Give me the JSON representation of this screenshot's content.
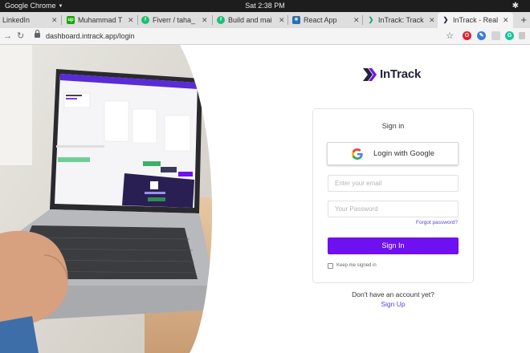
{
  "system_bar": {
    "app_name": "Google Chrome",
    "clock": "Sat   2:38 PM",
    "tray_icon": "slack-icon"
  },
  "tabs": [
    {
      "label": "LinkedIn",
      "favicon": "linkedin-favicon"
    },
    {
      "label": "Muhammad T",
      "favicon": "upwork-favicon",
      "favicon_text": "up",
      "favicon_color": "#14a800"
    },
    {
      "label": "Fiverr / taha_",
      "favicon": "fiverr-favicon",
      "favicon_text": "f",
      "favicon_color": "#1dbf73"
    },
    {
      "label": "Build and mai",
      "favicon": "fiverr-favicon",
      "favicon_text": "f",
      "favicon_color": "#1dbf73"
    },
    {
      "label": "React App",
      "favicon": "react-favicon"
    },
    {
      "label": "InTrack: Track",
      "favicon": "intrack-favicon"
    },
    {
      "label": "InTrack - Real",
      "favicon": "intrack-favicon",
      "active": true
    }
  ],
  "address_bar": {
    "url": "dashboard.intrack.app/login"
  },
  "extensions": [
    {
      "name": "opera-icon",
      "color": "#e0212f"
    },
    {
      "name": "colorpick-icon",
      "color": "#3d7bd6"
    },
    {
      "name": "extension-grey-icon",
      "color": "#c8c8c8"
    },
    {
      "name": "grammarly-icon",
      "color": "#15c39a"
    },
    {
      "name": "extension-square-icon",
      "color": "#bdbdbd"
    }
  ],
  "brand": {
    "name": "InTrack",
    "accent": "#6f10f0",
    "dark": "#23233b"
  },
  "login": {
    "title": "Sign in",
    "google_button": "Login with Google",
    "email_placeholder": "Enter your email",
    "password_placeholder": "Your Password",
    "forgot_password": "Forgot password?",
    "submit": "Sign In",
    "remember_me": "Keep me signed in"
  },
  "footer": {
    "question": "Don't have an account yet?",
    "signup": "Sign Up"
  }
}
